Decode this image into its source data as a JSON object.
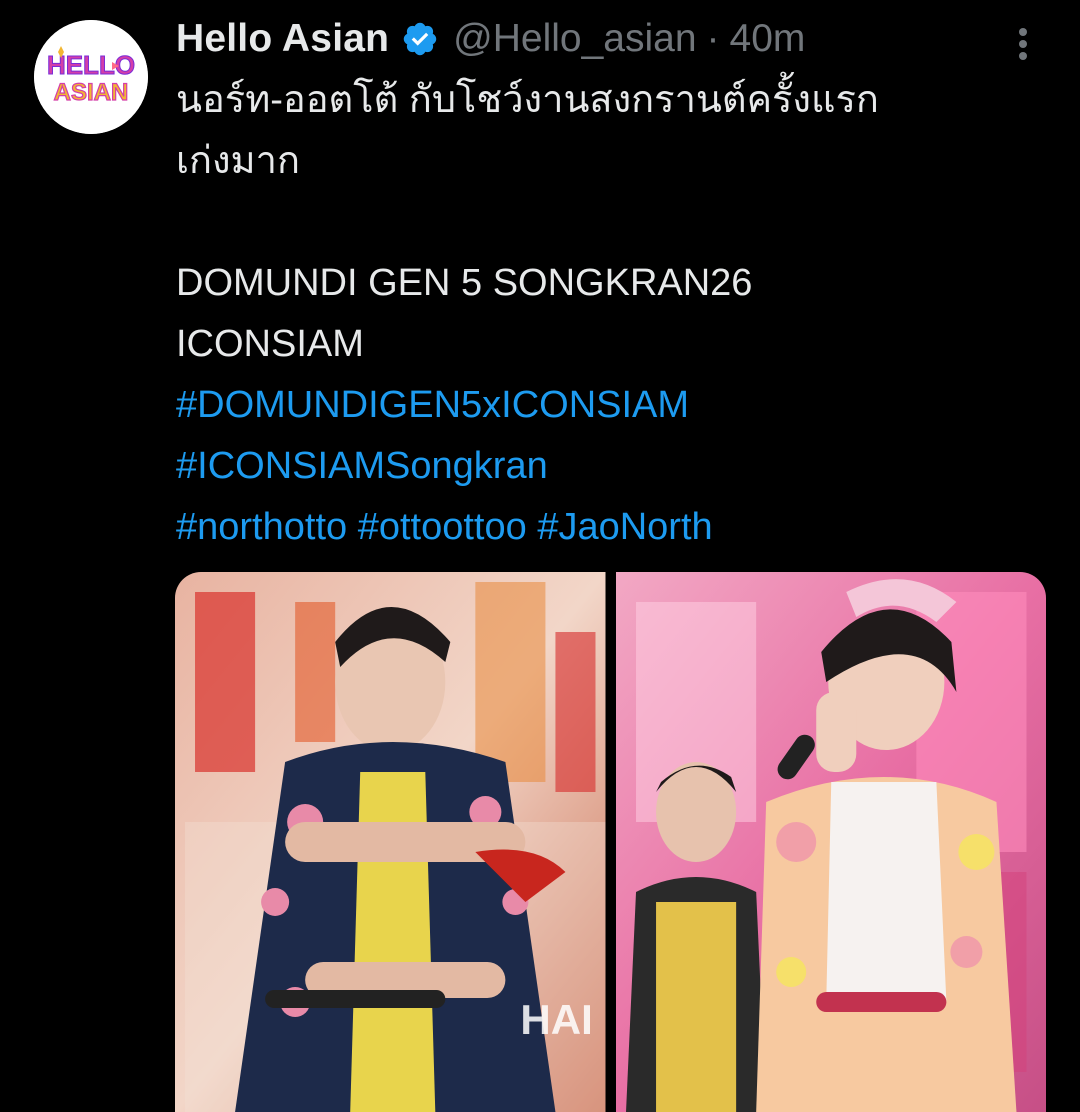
{
  "author": {
    "display_name": "Hello Asian",
    "handle": "@Hello_asian",
    "separator": "·",
    "time": "40m",
    "avatar_text_top": "HELLO",
    "avatar_text_bottom": "ASIAN"
  },
  "tweet": {
    "text_lines": [
      "นอร์ท-ออตโต้ กับโชว์งานสงกรานต์ครั้งแรก",
      "เก่งมาก",
      "",
      "DOMUNDI GEN 5 SONGKRAN26",
      "ICONSIAM"
    ],
    "hashtags": [
      "#DOMUNDIGEN5xICONSIAM",
      "#ICONSIAMSongkran",
      "#northotto",
      "#ottoottoo",
      "#JaoNorth"
    ],
    "hashtag_separator": " "
  },
  "media": {
    "photo_left_caption": "HAI",
    "count": 2
  },
  "icons": {
    "verified": "verified-badge-icon",
    "more": "more-vertical-icon"
  },
  "colors": {
    "background": "#000000",
    "text_primary": "#e7e9ea",
    "text_secondary": "#71767b",
    "link": "#1d9bf0",
    "verified_badge": "#1d9bf0"
  }
}
